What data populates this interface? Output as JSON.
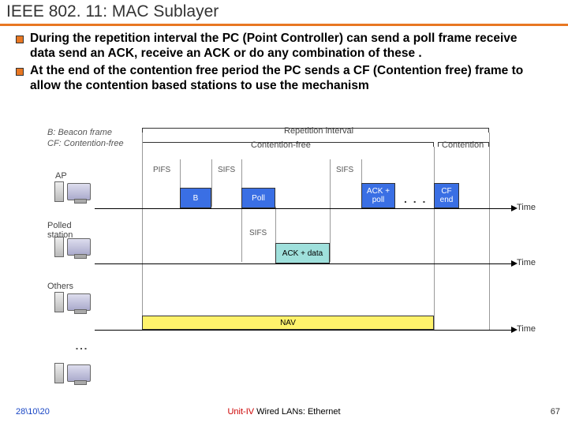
{
  "title": "IEEE 802. 11: MAC Sublayer",
  "bullets": [
    "During the repetition interval the PC (Point Controller) can send a poll frame receive data send an ACK, receive an ACK or do any combination of these .",
    "At the end of the contention free period the PC sends a CF (Contention free)  frame to allow the contention based stations to use the mechanism"
  ],
  "legend": {
    "b": "B: Beacon frame",
    "cf": "CF: Contention-free"
  },
  "brackets": {
    "rep": "Repetition interval",
    "cfree": "Contention-free",
    "cont": "Contention"
  },
  "gaps": {
    "pifs": "PIFS",
    "sifs": "SIFS"
  },
  "rows": {
    "ap": "AP",
    "polled": "Polled\nstation",
    "others": "Others"
  },
  "boxes": {
    "b": "B",
    "poll": "Poll",
    "ackpoll": "ACK +\npoll",
    "cfend": "CF\nend",
    "ackdata": "ACK + data",
    "nav": "NAV"
  },
  "timelabel": "Time",
  "dots": ". . .",
  "footer": {
    "date": "28\\10\\20",
    "mid_red": "Unit-IV ",
    "mid_black": "Wired LANs: Ethernet",
    "page": "67"
  }
}
